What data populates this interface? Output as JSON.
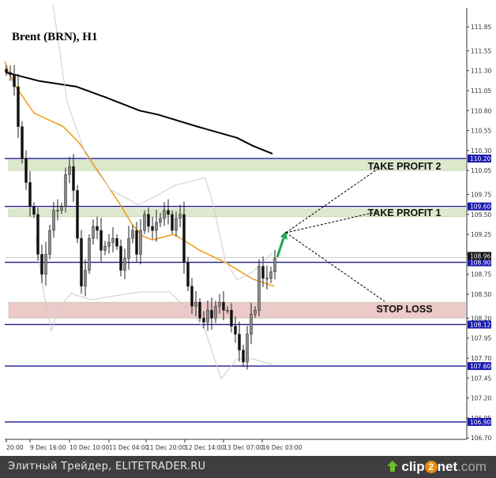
{
  "chart_data": {
    "type": "candlestick",
    "title": "Brent (BRN), H1",
    "ylim": [
      106.62,
      112.18
    ],
    "y_ticks": [
      "111.85",
      "111.55",
      "111.30",
      "111.05",
      "110.80",
      "110.55",
      "110.30",
      "110.05",
      "109.75",
      "109.50",
      "109.25",
      "109.00",
      "108.75",
      "108.50",
      "108.20",
      "107.95",
      "107.70",
      "107.45",
      "107.20",
      "106.95",
      "106.70"
    ],
    "x_ticks": [
      {
        "i": 0,
        "label": "20:00"
      },
      {
        "i": 6,
        "label": "9 Dec 16:00"
      },
      {
        "i": 16,
        "label": "10 Dec 10:00"
      },
      {
        "i": 26,
        "label": "11 Dec 04:00"
      },
      {
        "i": 35.4,
        "label": "11 Dec 20:00"
      },
      {
        "i": 45.2,
        "label": "12 Dec 14:00"
      },
      {
        "i": 55,
        "label": "13 Dec 07:00"
      },
      {
        "i": 64.8,
        "label": "16 Dec 03:00"
      }
    ],
    "open_first": 111.32,
    "closes": [
      111.28,
      111.25,
      111.1,
      110.6,
      110.2,
      109.9,
      109.6,
      109.5,
      109.0,
      108.75,
      109.0,
      109.3,
      109.55,
      109.55,
      109.6,
      110.0,
      110.1,
      109.8,
      109.2,
      108.6,
      108.8,
      109.2,
      109.35,
      109.3,
      109.05,
      109.1,
      109.15,
      109.2,
      109.1,
      108.8,
      108.95,
      109.2,
      109.3,
      109.0,
      109.3,
      109.5,
      109.35,
      109.3,
      109.4,
      109.45,
      109.55,
      109.5,
      109.3,
      109.45,
      109.5,
      108.9,
      108.6,
      108.35,
      108.4,
      108.2,
      108.15,
      108.3,
      108.2,
      108.35,
      108.4,
      108.3,
      108.3,
      108.1,
      108.0,
      107.8,
      107.65,
      108.0,
      108.25,
      108.3,
      108.85,
      108.7,
      108.7,
      108.78,
      108.95
    ],
    "series": [
      {
        "name": "MA fast",
        "color": "#f0a020",
        "points": [
          [
            -0.4,
            111.42
          ],
          [
            0.4,
            111.3
          ],
          [
            2.4,
            111.1
          ],
          [
            7,
            110.77
          ],
          [
            14.4,
            110.6
          ],
          [
            18.4,
            110.4
          ],
          [
            21,
            110.21
          ],
          [
            25,
            109.91
          ],
          [
            29,
            109.61
          ],
          [
            31.8,
            109.38
          ],
          [
            34.4,
            109.23
          ],
          [
            37,
            109.18
          ],
          [
            42.4,
            109.25
          ],
          [
            45.8,
            109.15
          ],
          [
            49,
            109.05
          ],
          [
            55.8,
            108.89
          ],
          [
            62.4,
            108.69
          ],
          [
            67.8,
            108.6
          ]
        ]
      },
      {
        "name": "MA slow",
        "color": "#000000",
        "points": [
          [
            -0.2,
            111.28
          ],
          [
            8.4,
            111.17
          ],
          [
            17.8,
            111.1
          ],
          [
            25,
            110.97
          ],
          [
            33.8,
            110.8
          ],
          [
            38.4,
            110.75
          ],
          [
            48.4,
            110.6
          ],
          [
            58.4,
            110.46
          ],
          [
            62.4,
            110.36
          ],
          [
            67.4,
            110.26
          ]
        ]
      },
      {
        "name": "Bollinger upper",
        "color": "#cccccc",
        "points": [
          [
            11.8,
            112.14
          ],
          [
            15.4,
            110.9
          ],
          [
            20.4,
            110.21
          ],
          [
            26.4,
            109.81
          ],
          [
            33.4,
            109.62
          ],
          [
            39.4,
            109.77
          ],
          [
            42.4,
            109.86
          ],
          [
            46.4,
            109.91
          ],
          [
            50.4,
            109.96
          ],
          [
            52.4,
            109.62
          ],
          [
            55.4,
            108.93
          ],
          [
            58.4,
            108.68
          ],
          [
            62.4,
            108.78
          ],
          [
            67.4,
            109.02
          ]
        ]
      },
      {
        "name": "Bollinger lower",
        "color": "#cccccc",
        "points": [
          [
            7.4,
            109.22
          ],
          [
            9.4,
            108.53
          ],
          [
            11.4,
            108.04
          ],
          [
            13.4,
            108.33
          ],
          [
            16.4,
            108.51
          ],
          [
            21.4,
            108.43
          ],
          [
            27.4,
            108.48
          ],
          [
            34.4,
            108.53
          ],
          [
            41.4,
            108.53
          ],
          [
            48.4,
            108.18
          ],
          [
            50.4,
            108.04
          ],
          [
            54.4,
            107.44
          ],
          [
            58.4,
            107.69
          ],
          [
            62.4,
            107.69
          ],
          [
            67.4,
            107.62
          ]
        ]
      }
    ],
    "levels": [
      "110.20",
      "109.60",
      "108.90",
      "108.12",
      "107.60",
      "106.90"
    ],
    "current_price": "108.96",
    "zones": [
      {
        "name": "take-profit-2",
        "label": "TAKE PROFIT 2",
        "from": 110.05,
        "to": 110.18,
        "color": "#dde9cc"
      },
      {
        "name": "take-profit-1",
        "label": "TAKE PROFIT 1",
        "from": 109.47,
        "to": 109.57,
        "color": "#dde9cc"
      },
      {
        "name": "stop-loss",
        "label": "STOP LOSS",
        "from": 108.2,
        "to": 108.4,
        "color": "#eccac8"
      }
    ]
  },
  "footer": {
    "text": "Элитный Трейдер, ELITETRADER.RU",
    "logo_clip": "clip",
    "logo_two": "2",
    "logo_net": "net",
    "logo_com": ".com"
  }
}
